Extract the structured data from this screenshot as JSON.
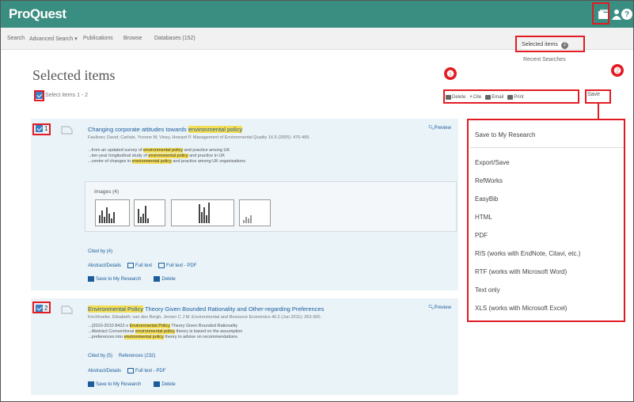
{
  "header": {
    "logo": "ProQuest",
    "help": "?"
  },
  "nav": {
    "items": [
      "Search",
      "Advanced Search ▾",
      "Publications",
      "Browse",
      "Databases (152)"
    ]
  },
  "selected_items_link": {
    "label": "Selected items",
    "count": "2"
  },
  "recent_searches": "Recent Searches",
  "page_title": "Selected items",
  "select_all": "Select items 1 - 2",
  "toolbar": {
    "delete": "Delete",
    "cite": "Cite",
    "email": "Email",
    "print": "Print",
    "save": "Save"
  },
  "badges": [
    "❶",
    "❷"
  ],
  "results": [
    {
      "number": "1",
      "title_pre": "Changing corporate attitudes towards ",
      "title_hl": "environmental policy",
      "preview": "Preview",
      "meta": "Faulkner, David; Carlisle, Yvonne M; Viney, Howard P. Management of Environmental Quality 16.5 (2005): 476-489.",
      "bullets": [
        {
          "pre": "...from an updated survey of ",
          "hl": "environmental policy",
          "post": " and practice among UK"
        },
        {
          "pre": "...ten-year longitudinal study of ",
          "hl": "environmental policy",
          "post": " and practice in UK"
        },
        {
          "pre": "...centre of changes in ",
          "hl": "environmental policy",
          "post": " and practice among UK organisations"
        }
      ],
      "images_label": "Images (4)",
      "cited_by": "Cited by (4)",
      "links": [
        "Abstract/Details",
        "Full text",
        "Full text - PDF"
      ],
      "actions": [
        "Save to My Research",
        "Delete"
      ]
    },
    {
      "number": "2",
      "title_hl": "Environmental Policy",
      "title_post": " Theory Given Bounded Rationality and Other-regarding Preferences",
      "preview": "Preview",
      "meta": "Kirchhoefer, Elisabeth; van den Bergh, Jeroen C J M. Environmental and Resource Economics 46.2 (Jun 2011): 263-300.",
      "bullets": [
        {
          "pre": "...(2010-2010 8422-z ",
          "hl": "Environmental Policy",
          "post": " Theory Given Bounded Rationality"
        },
        {
          "pre": "...Abstract Conventional ",
          "hl": "environmental policy",
          "post": " theory is based on the assumption"
        },
        {
          "pre": "...preferences into ",
          "hl": "environmental policy",
          "post": " theory to advise on recommendations"
        }
      ],
      "cited_by": "Cited by (5)",
      "references": "References (232)",
      "links": [
        "Abstract/Details",
        "Full text - PDF"
      ],
      "actions": [
        "Save to My Research",
        "Delete"
      ]
    }
  ],
  "save_menu": {
    "items": [
      "Save to My Research",
      "Export/Save",
      "RefWorks",
      "EasyBib",
      "HTML",
      "PDF",
      "RIS (works with EndNote, Citavi, etc.)",
      "RTF (works with Microsoft Word)",
      "Text only",
      "XLS (works with Microsoft Excel)"
    ]
  },
  "colors": {
    "header_bg": "#3a8d81",
    "highlight": "#f6df55",
    "callout_red": "#e21b23",
    "result_bg": "#e9f3f8",
    "link_blue": "#1d5c9b"
  }
}
